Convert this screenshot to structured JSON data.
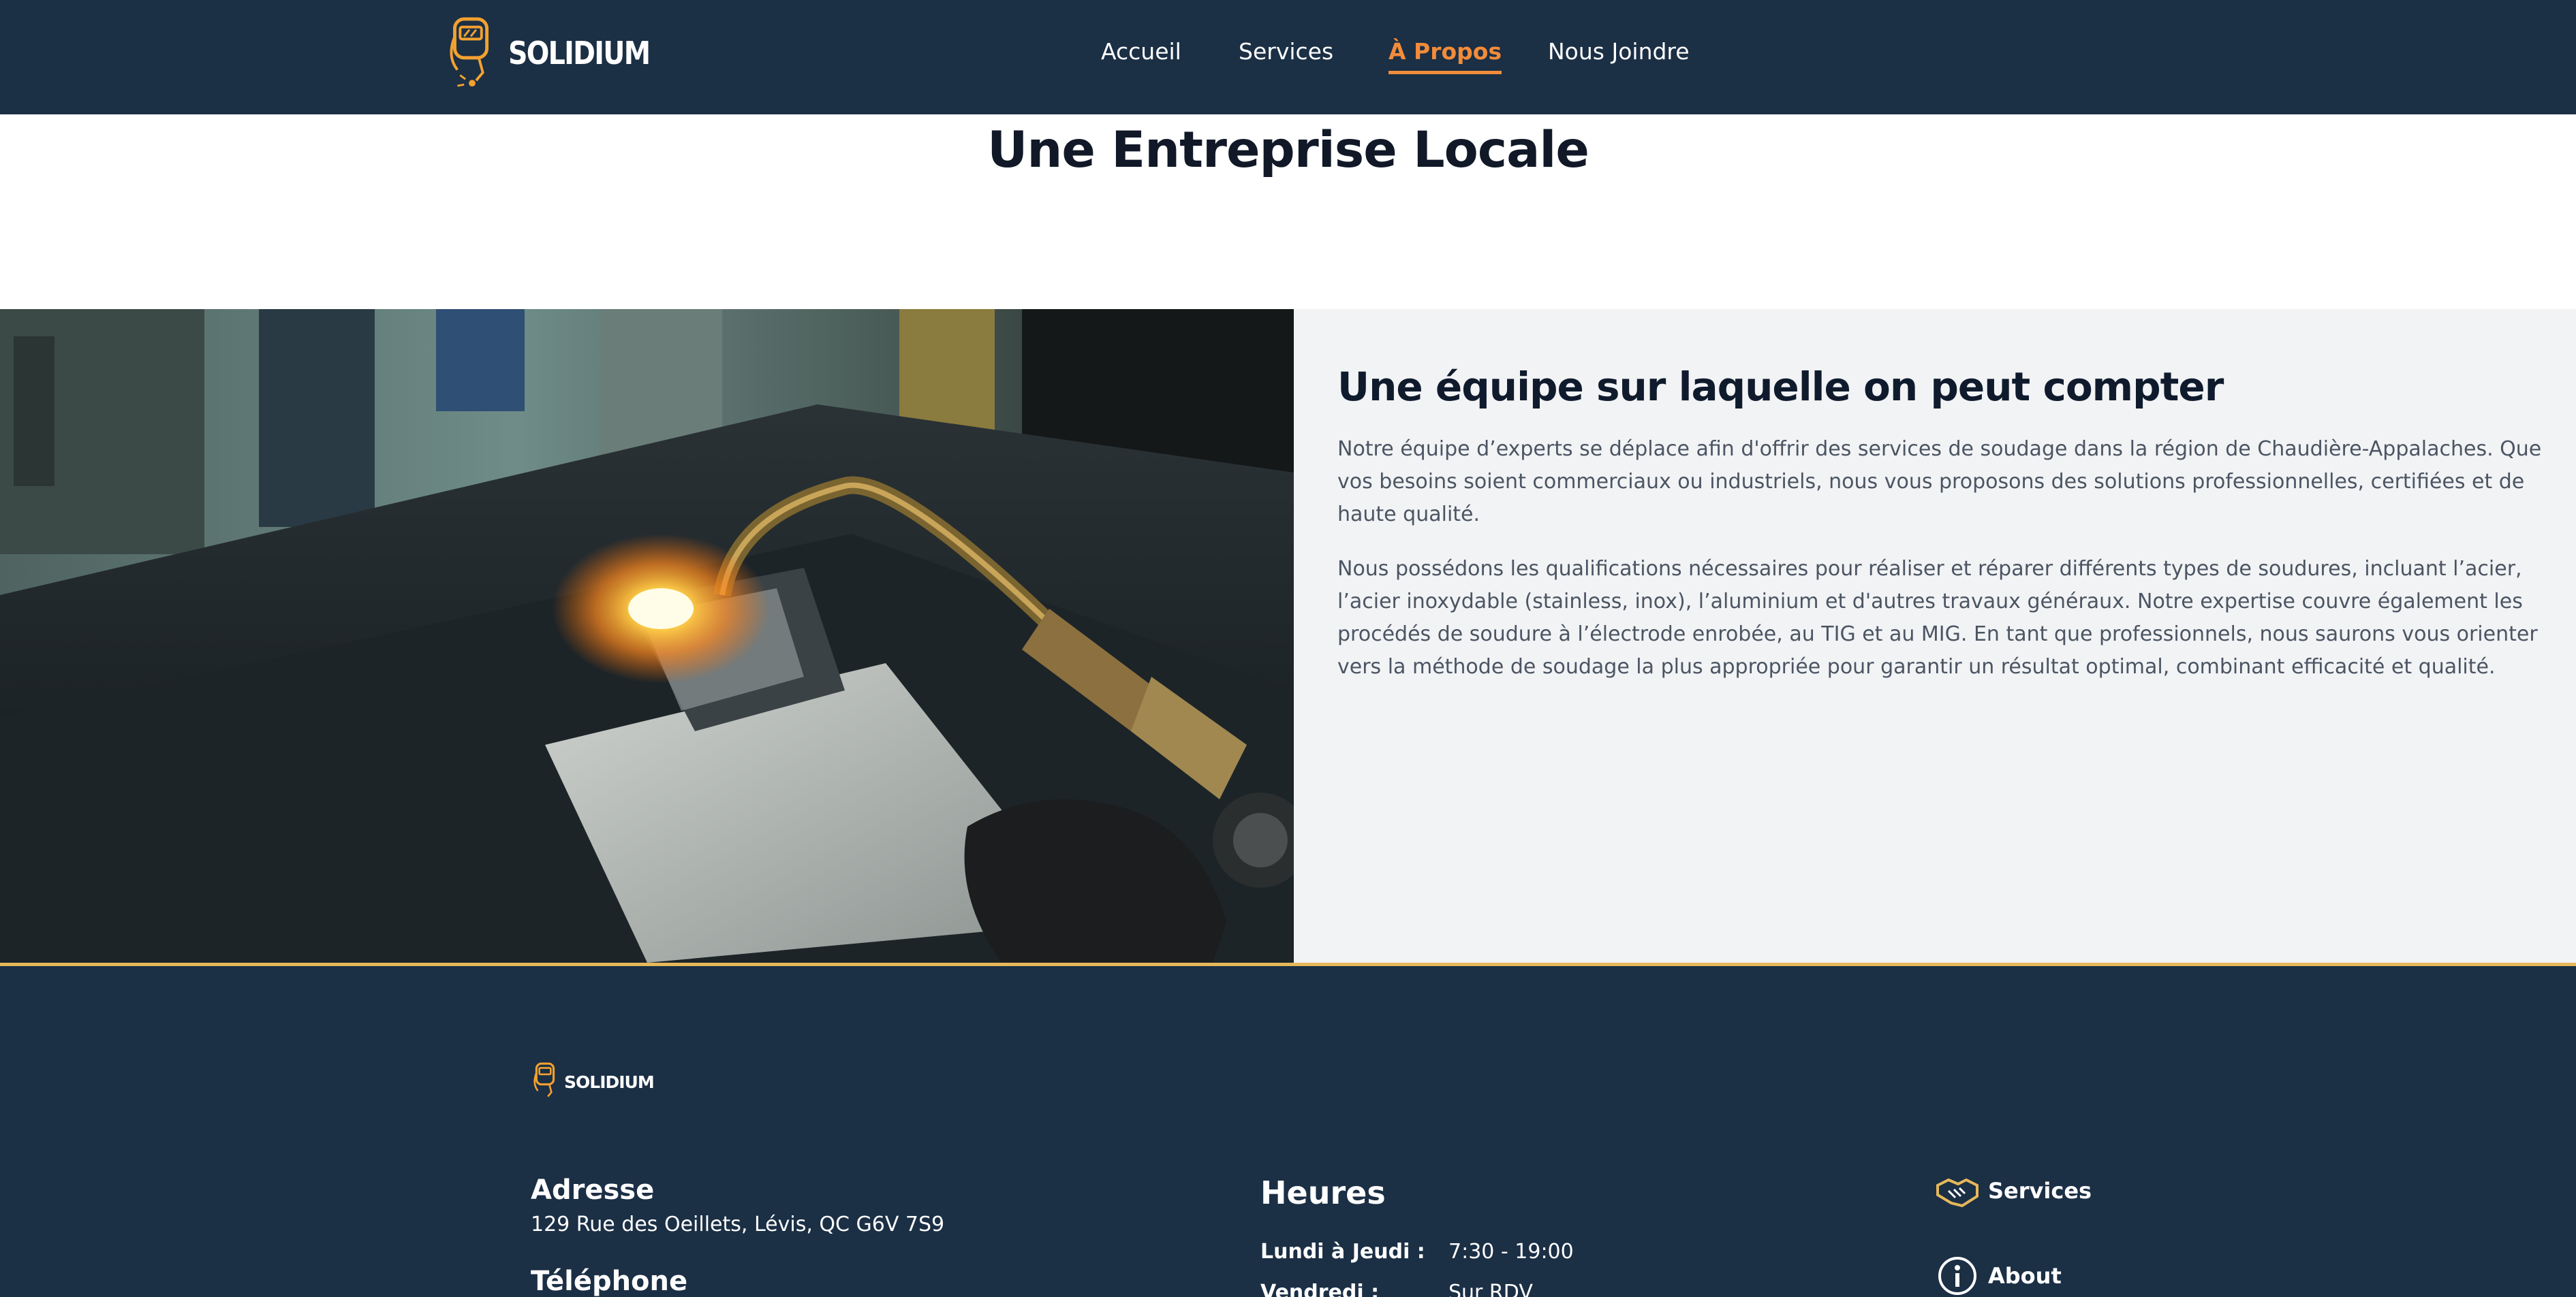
{
  "header": {
    "brand": "SOLIDIUM",
    "nav": [
      {
        "label": "Accueil",
        "active": false
      },
      {
        "label": "Services",
        "active": false
      },
      {
        "label": "À Propos",
        "active": true
      },
      {
        "label": "Nous Joindre",
        "active": false
      }
    ]
  },
  "hero": {
    "title": "Une Entreprise Locale"
  },
  "feature": {
    "heading": "Une équipe sur laquelle on peut compter",
    "paragraph1": "Notre équipe d’experts se déplace afin d'offrir des services de soudage dans la région de Chaudière-Appalaches. Que vos besoins soient commerciaux ou industriels, nous vous proposons des solutions professionnelles, certifiées et de haute qualité.",
    "paragraph2": "Nous possédons les qualifications nécessaires pour réaliser et réparer différents types de soudures, incluant l’acier, l’acier inoxydable (stainless, inox), l’aluminium et d'autres travaux généraux. Notre expertise couvre également les procédés de soudure à l’électrode enrobée, au TIG et au MIG. En tant que professionnels, nous saurons vous orienter vers la méthode de soudage la plus appropriée pour garantir un résultat optimal, combinant efficacité et qualité."
  },
  "footer": {
    "brand": "SOLIDIUM",
    "address_heading": "Adresse",
    "address": "129 Rue des Oeillets, Lévis, QC G6V 7S9",
    "phone_heading": "Téléphone",
    "hours_heading": "Heures",
    "hours": [
      {
        "day": "Lundi à Jeudi :",
        "time": "7:30 - 19:00"
      },
      {
        "day": "Vendredi :",
        "time": "Sur RDV"
      }
    ],
    "links": [
      {
        "label": "Services",
        "icon": "handshake-icon"
      },
      {
        "label": "About",
        "icon": "info-icon"
      }
    ]
  },
  "colors": {
    "navy": "#1b2f45",
    "accent": "#f28c3a",
    "gold": "#e6b85a",
    "light_bg": "#f2f3f5"
  }
}
